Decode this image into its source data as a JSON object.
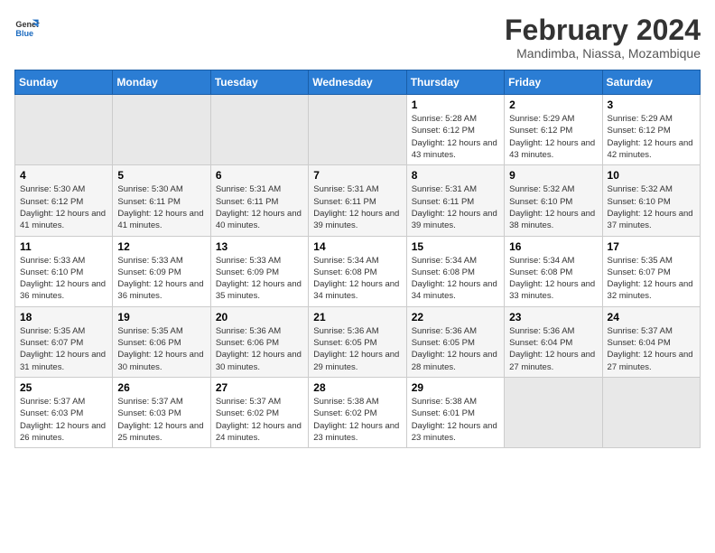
{
  "logo": {
    "line1": "General",
    "line2": "Blue"
  },
  "title": "February 2024",
  "subtitle": "Mandimba, Niassa, Mozambique",
  "weekdays": [
    "Sunday",
    "Monday",
    "Tuesday",
    "Wednesday",
    "Thursday",
    "Friday",
    "Saturday"
  ],
  "weeks": [
    [
      {
        "day": "",
        "empty": true
      },
      {
        "day": "",
        "empty": true
      },
      {
        "day": "",
        "empty": true
      },
      {
        "day": "",
        "empty": true
      },
      {
        "day": "1",
        "sunrise": "5:28 AM",
        "sunset": "6:12 PM",
        "daylight": "12 hours and 43 minutes."
      },
      {
        "day": "2",
        "sunrise": "5:29 AM",
        "sunset": "6:12 PM",
        "daylight": "12 hours and 43 minutes."
      },
      {
        "day": "3",
        "sunrise": "5:29 AM",
        "sunset": "6:12 PM",
        "daylight": "12 hours and 42 minutes."
      }
    ],
    [
      {
        "day": "4",
        "sunrise": "5:30 AM",
        "sunset": "6:12 PM",
        "daylight": "12 hours and 41 minutes."
      },
      {
        "day": "5",
        "sunrise": "5:30 AM",
        "sunset": "6:11 PM",
        "daylight": "12 hours and 41 minutes."
      },
      {
        "day": "6",
        "sunrise": "5:31 AM",
        "sunset": "6:11 PM",
        "daylight": "12 hours and 40 minutes."
      },
      {
        "day": "7",
        "sunrise": "5:31 AM",
        "sunset": "6:11 PM",
        "daylight": "12 hours and 39 minutes."
      },
      {
        "day": "8",
        "sunrise": "5:31 AM",
        "sunset": "6:11 PM",
        "daylight": "12 hours and 39 minutes."
      },
      {
        "day": "9",
        "sunrise": "5:32 AM",
        "sunset": "6:10 PM",
        "daylight": "12 hours and 38 minutes."
      },
      {
        "day": "10",
        "sunrise": "5:32 AM",
        "sunset": "6:10 PM",
        "daylight": "12 hours and 37 minutes."
      }
    ],
    [
      {
        "day": "11",
        "sunrise": "5:33 AM",
        "sunset": "6:10 PM",
        "daylight": "12 hours and 36 minutes."
      },
      {
        "day": "12",
        "sunrise": "5:33 AM",
        "sunset": "6:09 PM",
        "daylight": "12 hours and 36 minutes."
      },
      {
        "day": "13",
        "sunrise": "5:33 AM",
        "sunset": "6:09 PM",
        "daylight": "12 hours and 35 minutes."
      },
      {
        "day": "14",
        "sunrise": "5:34 AM",
        "sunset": "6:08 PM",
        "daylight": "12 hours and 34 minutes."
      },
      {
        "day": "15",
        "sunrise": "5:34 AM",
        "sunset": "6:08 PM",
        "daylight": "12 hours and 34 minutes."
      },
      {
        "day": "16",
        "sunrise": "5:34 AM",
        "sunset": "6:08 PM",
        "daylight": "12 hours and 33 minutes."
      },
      {
        "day": "17",
        "sunrise": "5:35 AM",
        "sunset": "6:07 PM",
        "daylight": "12 hours and 32 minutes."
      }
    ],
    [
      {
        "day": "18",
        "sunrise": "5:35 AM",
        "sunset": "6:07 PM",
        "daylight": "12 hours and 31 minutes."
      },
      {
        "day": "19",
        "sunrise": "5:35 AM",
        "sunset": "6:06 PM",
        "daylight": "12 hours and 30 minutes."
      },
      {
        "day": "20",
        "sunrise": "5:36 AM",
        "sunset": "6:06 PM",
        "daylight": "12 hours and 30 minutes."
      },
      {
        "day": "21",
        "sunrise": "5:36 AM",
        "sunset": "6:05 PM",
        "daylight": "12 hours and 29 minutes."
      },
      {
        "day": "22",
        "sunrise": "5:36 AM",
        "sunset": "6:05 PM",
        "daylight": "12 hours and 28 minutes."
      },
      {
        "day": "23",
        "sunrise": "5:36 AM",
        "sunset": "6:04 PM",
        "daylight": "12 hours and 27 minutes."
      },
      {
        "day": "24",
        "sunrise": "5:37 AM",
        "sunset": "6:04 PM",
        "daylight": "12 hours and 27 minutes."
      }
    ],
    [
      {
        "day": "25",
        "sunrise": "5:37 AM",
        "sunset": "6:03 PM",
        "daylight": "12 hours and 26 minutes."
      },
      {
        "day": "26",
        "sunrise": "5:37 AM",
        "sunset": "6:03 PM",
        "daylight": "12 hours and 25 minutes."
      },
      {
        "day": "27",
        "sunrise": "5:37 AM",
        "sunset": "6:02 PM",
        "daylight": "12 hours and 24 minutes."
      },
      {
        "day": "28",
        "sunrise": "5:38 AM",
        "sunset": "6:02 PM",
        "daylight": "12 hours and 23 minutes."
      },
      {
        "day": "29",
        "sunrise": "5:38 AM",
        "sunset": "6:01 PM",
        "daylight": "12 hours and 23 minutes."
      },
      {
        "day": "",
        "empty": true
      },
      {
        "day": "",
        "empty": true
      }
    ]
  ]
}
